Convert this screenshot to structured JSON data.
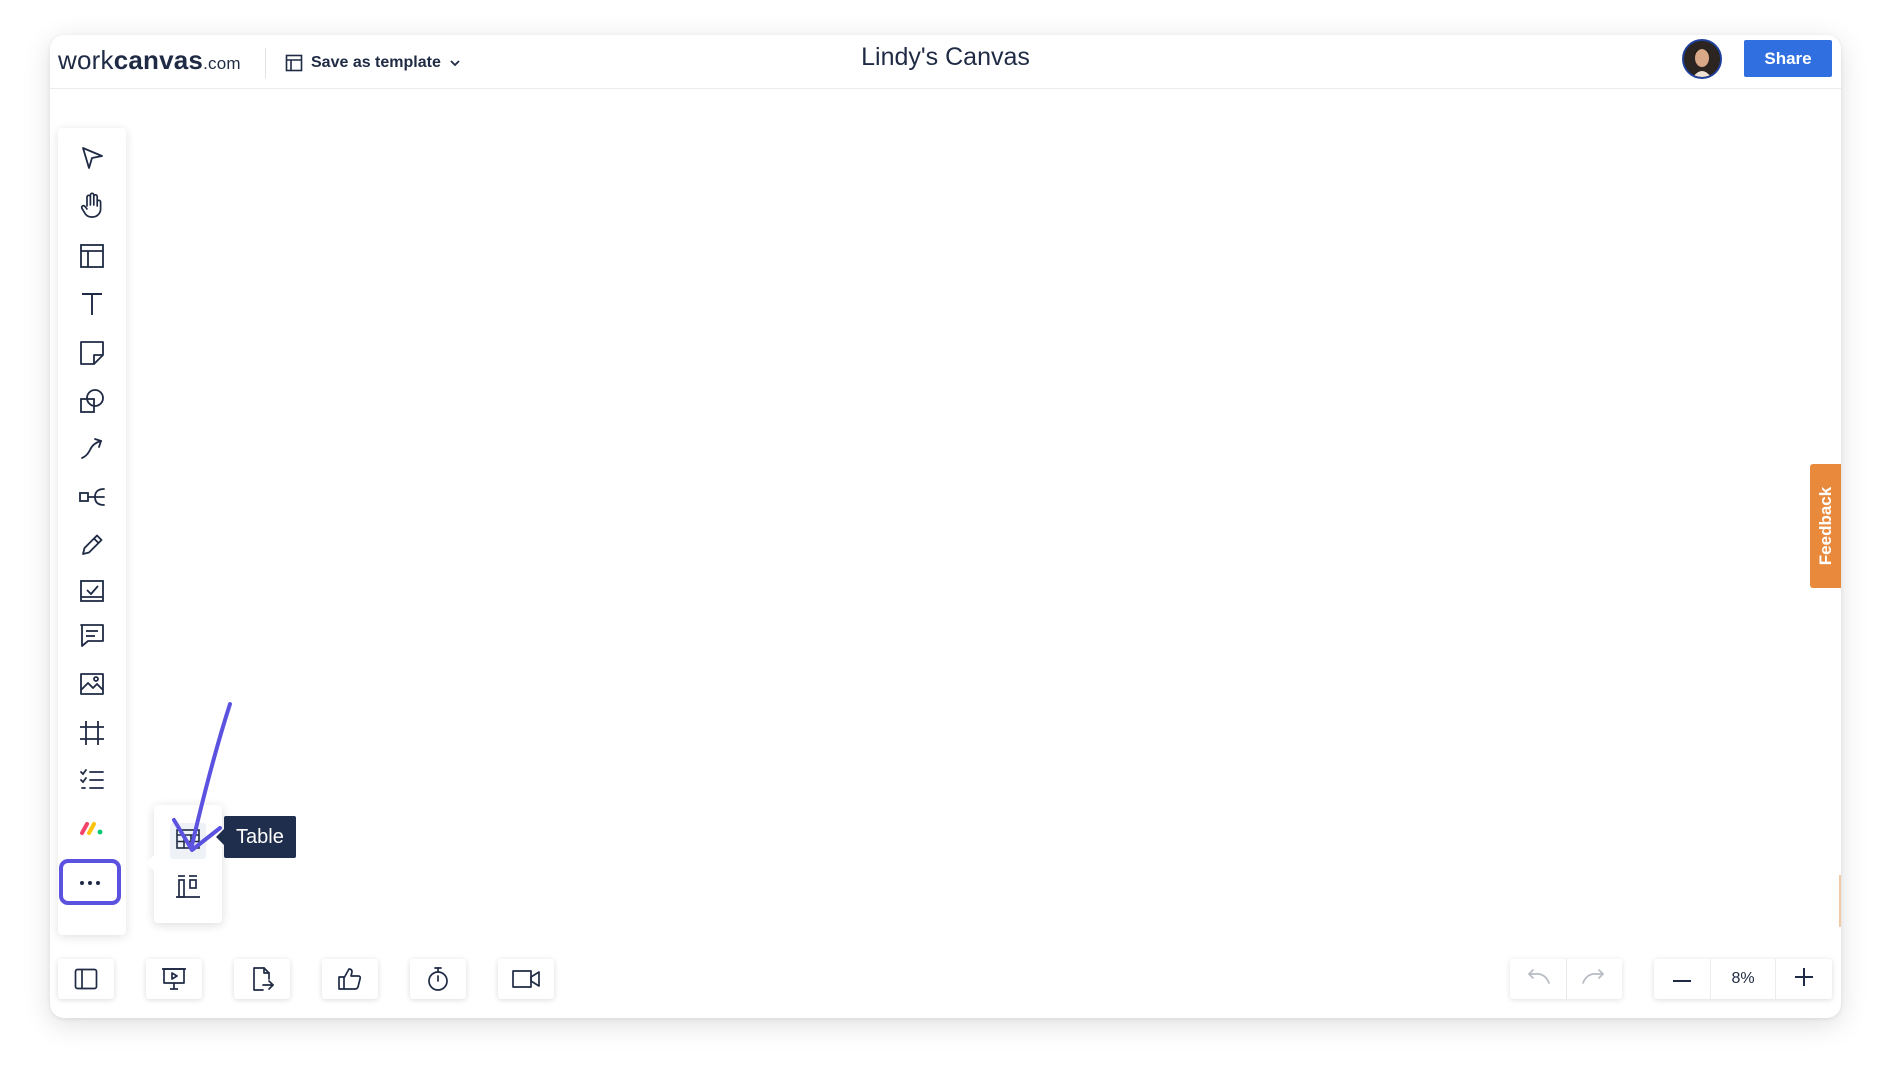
{
  "header": {
    "logo": {
      "part1": "work",
      "part2": "canvas",
      "part3": ".com"
    },
    "save_template_label": "Save as template",
    "canvas_title": "Lindy's Canvas",
    "share_label": "Share"
  },
  "left_toolbar": {
    "tools": [
      {
        "icon": "select-pointer-icon"
      },
      {
        "icon": "hand-pan-icon"
      },
      {
        "icon": "template-layout-icon"
      },
      {
        "icon": "text-icon"
      },
      {
        "icon": "sticky-note-icon"
      },
      {
        "icon": "shapes-icon"
      },
      {
        "icon": "connector-line-icon"
      },
      {
        "icon": "mind-map-icon"
      },
      {
        "icon": "pen-icon"
      },
      {
        "icon": "task-card-icon"
      },
      {
        "icon": "comment-icon"
      },
      {
        "icon": "image-icon"
      },
      {
        "icon": "frame-icon"
      },
      {
        "icon": "checklist-icon"
      },
      {
        "icon": "monday-app-icon"
      },
      {
        "icon": "more-dots-icon"
      }
    ]
  },
  "more_popup": {
    "items": [
      {
        "icon": "table-icon",
        "tooltip": "Table"
      },
      {
        "icon": "kanban-icon"
      }
    ]
  },
  "feedback_label": "Feedback",
  "bottom_bar": {
    "left_icons": [
      "sidebar-toggle-icon",
      "presentation-icon",
      "export-file-icon",
      "vote-thumbs-up-icon",
      "timer-icon",
      "video-call-icon"
    ],
    "zoom_level": "8%"
  },
  "colors": {
    "accent_blue": "#2f6fe0",
    "highlight_purple": "#5b52e0",
    "feedback_orange": "#e8893c",
    "tooltip_navy": "#1f2e4d",
    "icon_navy": "#1f2a44"
  }
}
